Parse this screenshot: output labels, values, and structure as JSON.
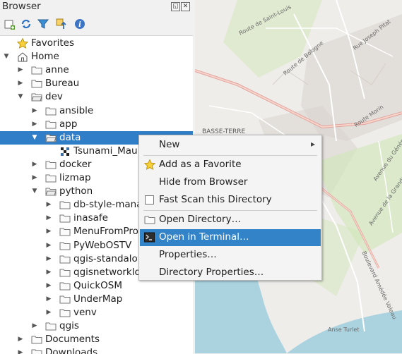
{
  "panel": {
    "title": "Browser",
    "float_button": "◱",
    "close_button": "✕",
    "toolbar": [
      "add-layer-icon",
      "refresh-icon",
      "filter-icon",
      "collapse-all-icon",
      "info-icon"
    ]
  },
  "tree": {
    "items": [
      {
        "label": "Favorites",
        "indent": 0,
        "arrow": "",
        "icon": "star"
      },
      {
        "label": "Home",
        "indent": 0,
        "arrow": "▼",
        "icon": "home"
      },
      {
        "label": "anne",
        "indent": 1,
        "arrow": "▶",
        "icon": "folder"
      },
      {
        "label": "Bureau",
        "indent": 1,
        "arrow": "▶",
        "icon": "folder"
      },
      {
        "label": "dev",
        "indent": 1,
        "arrow": "▼",
        "icon": "folder-open"
      },
      {
        "label": "ansible",
        "indent": 2,
        "arrow": "▶",
        "icon": "folder"
      },
      {
        "label": "app",
        "indent": 2,
        "arrow": "▶",
        "icon": "folder"
      },
      {
        "label": "data",
        "indent": 2,
        "arrow": "▼",
        "icon": "folder-open",
        "selected": true
      },
      {
        "label": "Tsunami_Mau",
        "indent": 3,
        "arrow": "",
        "icon": "raster"
      },
      {
        "label": "docker",
        "indent": 2,
        "arrow": "▶",
        "icon": "folder"
      },
      {
        "label": "lizmap",
        "indent": 2,
        "arrow": "▶",
        "icon": "folder"
      },
      {
        "label": "python",
        "indent": 2,
        "arrow": "▼",
        "icon": "folder-open"
      },
      {
        "label": "db-style-mana",
        "indent": 3,
        "arrow": "▶",
        "icon": "folder"
      },
      {
        "label": "inasafe",
        "indent": 3,
        "arrow": "▶",
        "icon": "folder"
      },
      {
        "label": "MenuFromPro",
        "indent": 3,
        "arrow": "▶",
        "icon": "folder"
      },
      {
        "label": "PyWebOSTV",
        "indent": 3,
        "arrow": "▶",
        "icon": "folder"
      },
      {
        "label": "qgis-standalo",
        "indent": 3,
        "arrow": "▶",
        "icon": "folder"
      },
      {
        "label": "qgisnetworklo",
        "indent": 3,
        "arrow": "▶",
        "icon": "folder"
      },
      {
        "label": "QuickOSM",
        "indent": 3,
        "arrow": "▶",
        "icon": "folder"
      },
      {
        "label": "UnderMap",
        "indent": 3,
        "arrow": "▶",
        "icon": "folder"
      },
      {
        "label": "venv",
        "indent": 3,
        "arrow": "▶",
        "icon": "folder"
      },
      {
        "label": "qgis",
        "indent": 2,
        "arrow": "▶",
        "icon": "folder"
      },
      {
        "label": "Documents",
        "indent": 1,
        "arrow": "▶",
        "icon": "folder"
      },
      {
        "label": "Downloads",
        "indent": 1,
        "arrow": "▶",
        "icon": "folder"
      }
    ]
  },
  "context_menu": {
    "items": [
      {
        "label": "New",
        "icon": "",
        "submenu": "▸"
      },
      {
        "sep": true
      },
      {
        "label": "Add as a Favorite",
        "icon": "star"
      },
      {
        "label": "Hide from Browser",
        "icon": ""
      },
      {
        "label": "Fast Scan this Directory",
        "icon": "checkbox"
      },
      {
        "sep": true
      },
      {
        "label": "Open Directory…",
        "icon": "folder"
      },
      {
        "label": "Open in Terminal…",
        "icon": "terminal",
        "highlighted": true
      },
      {
        "label": "Properties…",
        "icon": ""
      },
      {
        "label": "Directory Properties…",
        "icon": ""
      }
    ]
  },
  "map": {
    "labels": [
      "Route de Saint-Louis",
      "Rue Joseph Pitat",
      "Route de Bologne",
      "BASSE-TERRE",
      "Route Morin",
      "Avenue du Général",
      "Avenue de la Grande",
      "Boulevard Amédée Valeau",
      "Anse Turlet"
    ]
  },
  "colors": {
    "selection": "#2f7ec7",
    "menu_highlight": "#3383c9",
    "map_land": "#efedea",
    "map_sea": "#aad3df",
    "map_green": "#cfe7b6",
    "road_major": "#e3a3a0"
  }
}
